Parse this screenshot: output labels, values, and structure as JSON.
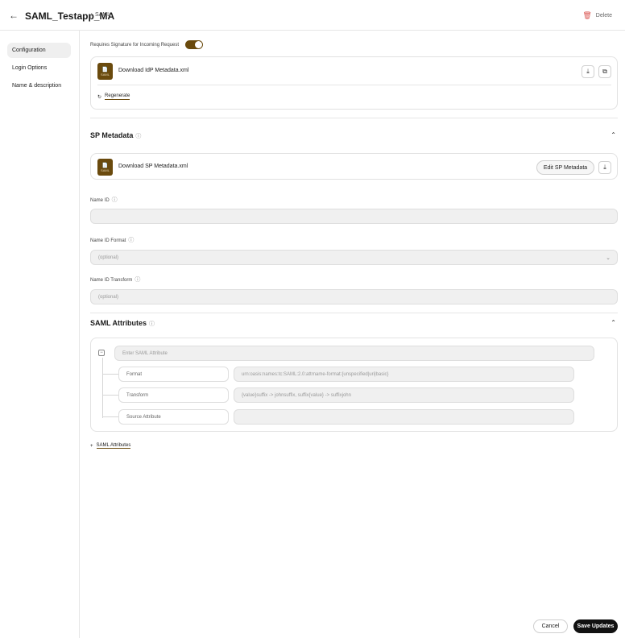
{
  "header": {
    "back_icon": "arrow-left-icon",
    "title": "SAML_Testapp_MA",
    "separator": "/",
    "crumb": "SAML",
    "delete_label": "Delete"
  },
  "sidebar": {
    "items": [
      {
        "label": "Configuration",
        "active": true
      },
      {
        "label": "Login Options",
        "active": false
      },
      {
        "label": "Name & description",
        "active": false
      }
    ]
  },
  "idp": {
    "signature_label": "Requires Signature for Incoming Request",
    "signature_enabled": true,
    "file_name": "Download IdP Metadata.xml",
    "badge_text": "SAML",
    "regenerate_label": "Regenerate"
  },
  "sp": {
    "title": "SP Metadata",
    "file_name": "Download SP Metadata.xml",
    "badge_text": "SAML",
    "edit_label": "Edit SP Metadata",
    "name_id_label": "Name ID",
    "name_id_value": "",
    "name_id_format_label": "Name ID Format",
    "name_id_format_placeholder": "(optional)",
    "name_id_transform_label": "Name ID Transform",
    "name_id_transform_placeholder": "(optional)"
  },
  "saml_attributes": {
    "title": "SAML Attributes",
    "attribute_placeholder": "Enter SAML Attribute",
    "rows": [
      {
        "label": "Format",
        "value": "urn:oasis:names:tc:SAML:2.0:attrname-format:{unspecified|uri|basic}"
      },
      {
        "label": "Transform",
        "value": "{value}suffix -> johnsuffix, suffix{value} -> suffixjohn"
      },
      {
        "label": "Source Attribute",
        "value": ""
      }
    ],
    "add_label": "SAML Attributes"
  },
  "footer": {
    "cancel_label": "Cancel",
    "save_label": "Save Updates"
  },
  "colors": {
    "accent": "#6a4a0d",
    "primary_button": "#111111"
  }
}
